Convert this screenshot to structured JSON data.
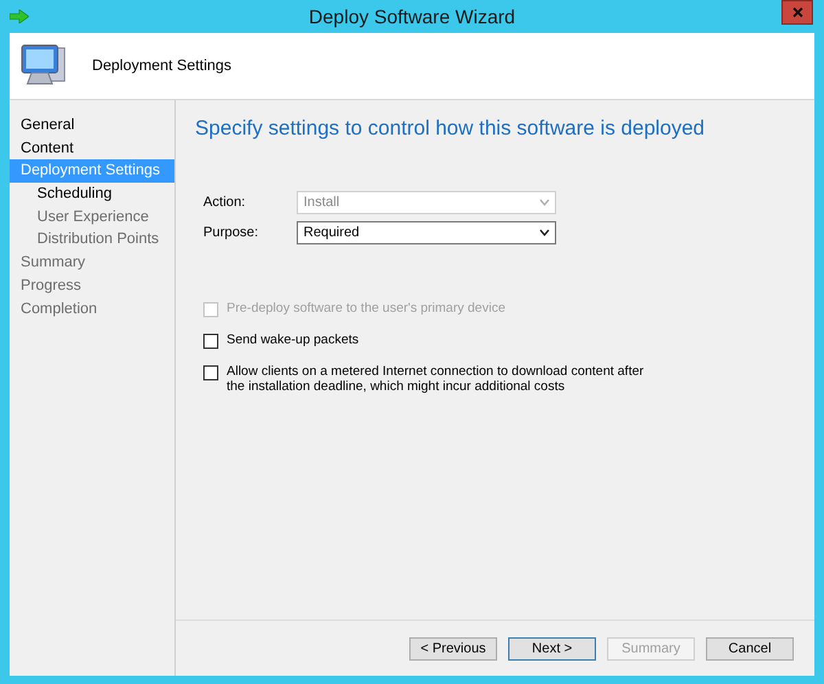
{
  "window": {
    "title": "Deploy Software Wizard"
  },
  "header": {
    "title": "Deployment Settings"
  },
  "nav": [
    {
      "label": "General",
      "selected": false,
      "enabled": true
    },
    {
      "label": "Content",
      "selected": false,
      "enabled": true
    },
    {
      "label": "Deployment Settings",
      "selected": true,
      "enabled": true,
      "children": [
        {
          "label": "Scheduling",
          "selected": false,
          "enabled": true
        },
        {
          "label": "User Experience",
          "selected": false,
          "enabled": false
        },
        {
          "label": "Distribution Points",
          "selected": false,
          "enabled": false
        }
      ]
    },
    {
      "label": "Summary",
      "selected": false,
      "enabled": false
    },
    {
      "label": "Progress",
      "selected": false,
      "enabled": false
    },
    {
      "label": "Completion",
      "selected": false,
      "enabled": false
    }
  ],
  "page": {
    "heading": "Specify settings to control how this software is deployed",
    "fields": [
      {
        "label": "Action:",
        "value": "Install",
        "disabled": true
      },
      {
        "label": "Purpose:",
        "value": "Required",
        "disabled": false
      }
    ],
    "options": [
      {
        "label": "Pre-deploy software to the user's primary device",
        "checked": false,
        "disabled": true
      },
      {
        "label": "Send wake-up packets",
        "checked": false,
        "disabled": false
      },
      {
        "label": "Allow clients on a metered Internet connection to download content after the installation deadline, which might incur additional costs",
        "checked": false,
        "disabled": false
      }
    ]
  },
  "buttons": [
    {
      "label": "< Previous",
      "disabled": false,
      "focused": false
    },
    {
      "label": "Next >",
      "disabled": false,
      "focused": true
    },
    {
      "label": "Summary",
      "disabled": true,
      "focused": false
    },
    {
      "label": "Cancel",
      "disabled": false,
      "focused": false
    }
  ]
}
